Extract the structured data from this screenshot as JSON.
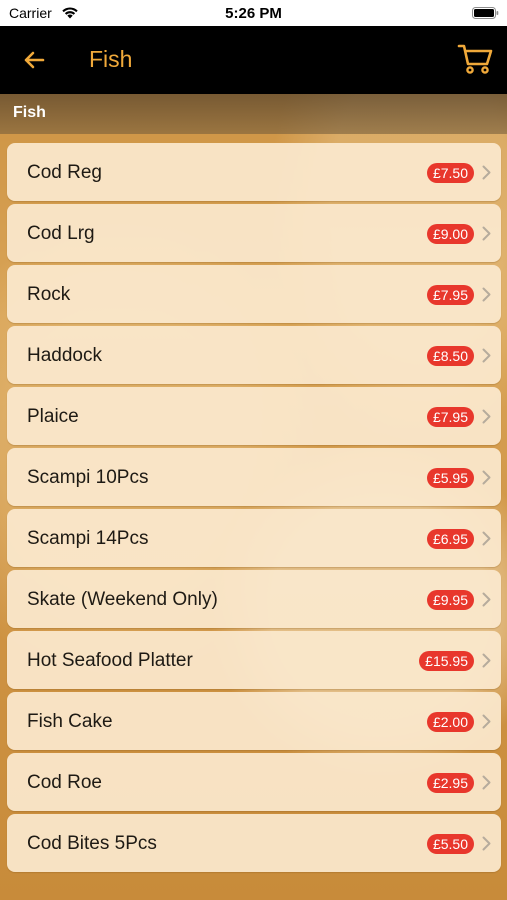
{
  "status_bar": {
    "carrier": "Carrier",
    "time": "5:26 PM"
  },
  "nav": {
    "title": "Fish",
    "back_icon": "back-arrow-icon",
    "cart_icon": "cart-icon"
  },
  "section": {
    "title": "Fish"
  },
  "colors": {
    "accent": "#f0a93a",
    "price_badge": "#e8372c",
    "nav_bg": "#000000"
  },
  "items": [
    {
      "name": "Cod Reg",
      "price": "£7.50"
    },
    {
      "name": "Cod Lrg",
      "price": "£9.00"
    },
    {
      "name": "Rock",
      "price": "£7.95"
    },
    {
      "name": "Haddock",
      "price": "£8.50"
    },
    {
      "name": "Plaice",
      "price": "£7.95"
    },
    {
      "name": "Scampi 10Pcs",
      "price": "£5.95"
    },
    {
      "name": "Scampi 14Pcs",
      "price": "£6.95"
    },
    {
      "name": "Skate (Weekend Only)",
      "price": "£9.95"
    },
    {
      "name": "Hot Seafood Platter",
      "price": "£15.95"
    },
    {
      "name": "Fish Cake",
      "price": "£2.00"
    },
    {
      "name": "Cod Roe",
      "price": "£2.95"
    },
    {
      "name": "Cod Bites 5Pcs",
      "price": "£5.50"
    }
  ]
}
